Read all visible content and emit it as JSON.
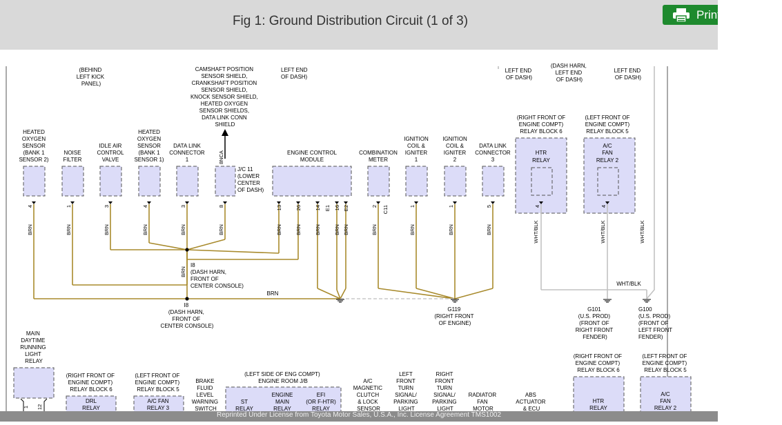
{
  "header": {
    "title": "Fig 1: Ground Distribution Circuit (1 of 3)",
    "print_label": "Print"
  },
  "colors": {
    "wire": "#a88a2c",
    "wire_gray": "#c2c2c2",
    "component_fill": "#dcdcf8",
    "header_bg": "#d9d9d9",
    "print_bg": "#1e8a2e"
  },
  "diagram": {
    "top_notes": [
      {
        "lines": [
          "(BEHIND",
          "LEFT KICK",
          "PANEL)"
        ]
      },
      {
        "lines": [
          "CAMSHAFT POSITION",
          "SENSOR SHIELD,",
          "CRANKSHAFT POSITION",
          "SENSOR SHIELD,",
          "KNOCK SENSOR SHIELD,",
          "HEATED OXYGEN",
          "SENSOR SHIELDS,",
          "DATA LINK CONN",
          "SHIELD"
        ]
      },
      {
        "lines": [
          "LEFT END",
          "OF DASH)"
        ]
      },
      {
        "lines": [
          "LEFT END",
          "OF DASH)"
        ]
      },
      {
        "lines": [
          "(DASH HARN,",
          "LEFT END",
          "OF DASH)"
        ]
      },
      {
        "lines": [
          "LEFT END",
          "OF DASH)"
        ]
      }
    ],
    "components": [
      {
        "label": [
          "HEATED",
          "OXYGEN",
          "SENSOR",
          "(BANK 1",
          "SENSOR 2)"
        ],
        "pin": "4",
        "wire": "BRN"
      },
      {
        "label": [
          "NOISE",
          "FILTER"
        ],
        "pin": "1",
        "wire": "BRN"
      },
      {
        "label": [
          "IDLE AIR",
          "CONTROL",
          "VALVE"
        ],
        "pin": "3",
        "wire": "BRN"
      },
      {
        "label": [
          "HEATED",
          "OXYGEN",
          "SENSOR",
          "(BANK 1",
          "SENSOR 1)"
        ],
        "pin": "4",
        "wire": "BRN"
      },
      {
        "label": [
          "DATA LINK",
          "CONNECTOR",
          "1"
        ],
        "pin": "3",
        "wire": "BRN"
      },
      {
        "label": [
          "ENGINE CONTROL",
          "MODULE"
        ],
        "pins": [
          "13",
          "26",
          "14",
          "E1",
          "16",
          "E2"
        ],
        "wires": [
          "BRN",
          "BRN",
          "BRN",
          "BRN",
          "BRN"
        ]
      },
      {
        "label": [
          "COMBINATION",
          "METER"
        ],
        "pin": "2",
        "pin2": "C11",
        "wire": "BRN"
      },
      {
        "label": [
          "IGNITION",
          "COIL &",
          "IGNITER",
          "1"
        ],
        "pin": "1",
        "wire": "BRN"
      },
      {
        "label": [
          "IGNITION",
          "COIL &",
          "IGNITER",
          "2"
        ],
        "pin": "1",
        "wire": "BRN"
      },
      {
        "label": [
          "DATA LINK",
          "CONNECTOR",
          "3"
        ],
        "pin": "5",
        "wire": "BRN"
      },
      {
        "label": [
          "HTR",
          "RELAY"
        ],
        "block": [
          "(RIGHT FRONT OF",
          "ENGINE COMPT)",
          "RELAY BLOCK 6"
        ],
        "pin": "4",
        "wire": "WHT/BLK"
      },
      {
        "label": [
          "A/C",
          "FAN",
          "RELAY 2"
        ],
        "block": [
          "(LEFT FRONT OF",
          "ENGINE COMPT)",
          "RELAY BLOCK 5"
        ],
        "pin": "4",
        "wire": "WHT/BLK"
      }
    ],
    "jc11": {
      "pin": "8",
      "pin_top": "8",
      "connector": "NCA",
      "wire": "BRN",
      "label": [
        "J/C 11",
        "(LOWER",
        "CENTER",
        "OF DASH)"
      ]
    },
    "splice_upper": {
      "label": [
        "I8",
        "(DASH HARN,",
        "FRONT OF",
        "CENTER CONSOLE)"
      ],
      "wire": "BRN"
    },
    "splice_lower": {
      "label": [
        "I8",
        "(DASH HARN,",
        "FRONT OF",
        "CENTER CONSOLE)"
      ]
    },
    "main_wire": "BRN",
    "wire_far_right": "WHT/BLK",
    "wire_whtblk_h": "WHT/BLK",
    "grounds": [
      {
        "label": [
          "G119",
          "(RIGHT FRONT",
          "OF ENGINE)"
        ]
      },
      {
        "label": [
          "G101",
          "(U.S. PROD)",
          "(FRONT OF",
          "RIGHT FRONT",
          "FENDER)"
        ]
      },
      {
        "label": [
          "G100",
          "(U.S. PROD)",
          "(FRONT OF",
          "LEFT FRONT",
          "FENDER)"
        ]
      }
    ],
    "bottom_components": [
      {
        "label": [
          "MAIN",
          "DAYTIME",
          "RUNNING",
          "LIGHT",
          "RELAY"
        ],
        "pins": [
          "1",
          "12"
        ]
      },
      {
        "block": [
          "(RIGHT FRONT OF",
          "ENGINE COMPT)",
          "RELAY BLOCK 6"
        ],
        "label": [
          "DRL",
          "RELAY"
        ]
      },
      {
        "block": [
          "(LEFT FRONT OF",
          "ENGINE COMPT)",
          "RELAY BLOCK 5"
        ],
        "label": [
          "A/C FAN",
          "RELAY 3"
        ]
      },
      {
        "label": [
          "BRAKE",
          "FLUID",
          "LEVEL",
          "WARNING",
          "SWITCH"
        ]
      },
      {
        "block": [
          "(LEFT SIDE OF ENG COMPT)",
          "ENGINE ROOM J/B"
        ],
        "parts": [
          [
            "ST",
            "RELAY"
          ],
          [
            "ENGINE",
            "MAIN",
            "RELAY"
          ],
          [
            "EFI",
            "(OR F-HTR)",
            "RELAY"
          ]
        ]
      },
      {
        "label": [
          "A/C",
          "MAGNETIC",
          "CLUTCH",
          "& LOCK",
          "SENSOR"
        ]
      },
      {
        "label": [
          "LEFT",
          "FRONT",
          "TURN",
          "SIGNAL/",
          "PARKING",
          "LIGHT"
        ]
      },
      {
        "label": [
          "RIGHT",
          "FRONT",
          "TURN",
          "SIGNAL/",
          "PARKING",
          "LIGHT"
        ]
      },
      {
        "label": [
          "RADIATOR",
          "FAN",
          "MOTOR"
        ]
      },
      {
        "label": [
          "ABS",
          "ACTUATOR",
          "& ECU"
        ]
      },
      {
        "block": [
          "(RIGHT FRONT OF",
          "ENGINE COMPT)",
          "RELAY BLOCK 6"
        ],
        "label": [
          "HTR",
          "RELAY"
        ]
      },
      {
        "block": [
          "(LEFT FRONT OF",
          "ENGINE COMPT)",
          "RELAY BLOCK 5"
        ],
        "label": [
          "A/C",
          "FAN",
          "RELAY 2"
        ]
      }
    ]
  },
  "footer": {
    "text": "Reprinted Under License from Toyota Motor Sales, U.S.A., Inc. License Agreement TMS1002"
  }
}
